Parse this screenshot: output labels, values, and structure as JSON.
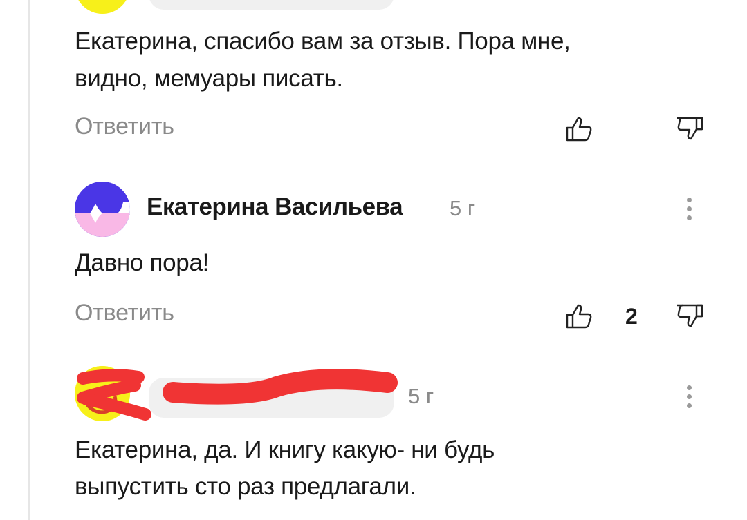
{
  "comments": [
    {
      "text_line1": "Екатерина, спасибо вам за отзыв. Пора мне,",
      "text_line2": "видно, мемуары писать.",
      "reply_label": "Ответить"
    },
    {
      "author": "Екатерина Васильева",
      "age": "5 г",
      "text": "Давно пора!",
      "reply_label": "Ответить",
      "like_count": "2"
    },
    {
      "age": "5 г",
      "text_line1": "Екатерина, да. И книгу какую- ни будь",
      "text_line2": "выпустить сто раз предлагали."
    }
  ],
  "icons": {
    "like": "thumbs-up-outline-icon",
    "dislike": "thumbs-down-outline-icon",
    "more": "vertical-dots-icon"
  },
  "colors": {
    "text": "#1a1a1a",
    "muted": "#8a8a8a",
    "avatar_blue": "#4a36e6",
    "avatar_pink": "#f9b8e6",
    "avatar_yellow": "#f7f01a",
    "redaction_red": "#f03434"
  }
}
